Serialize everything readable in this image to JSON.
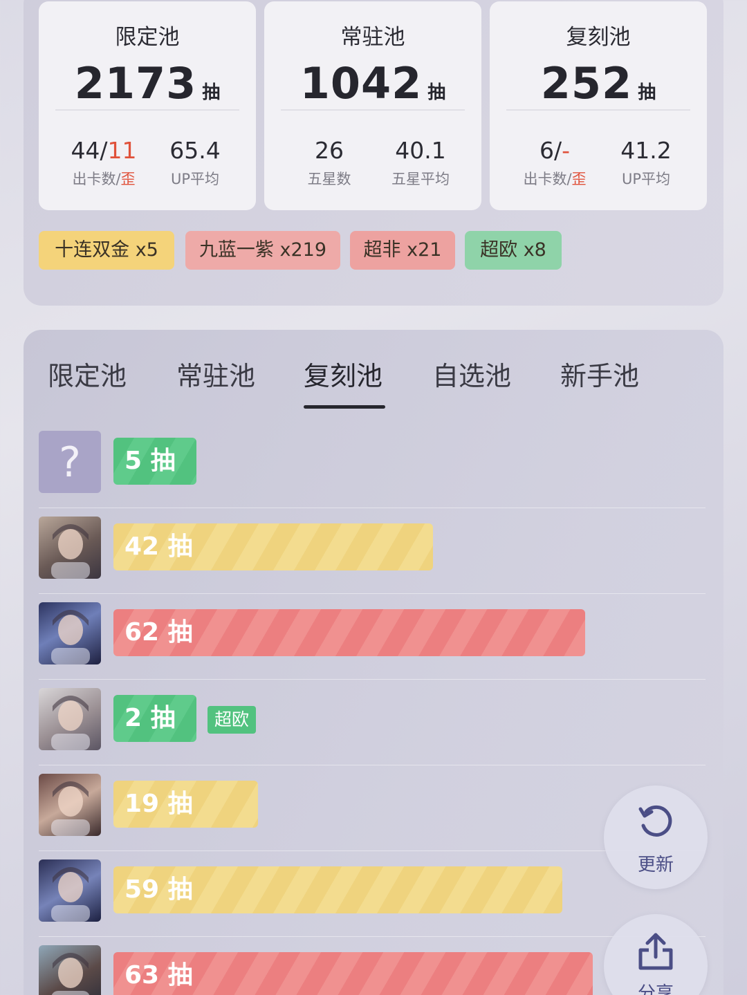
{
  "summary": {
    "cards": [
      {
        "title": "限定池",
        "count": "2173",
        "unit": "抽",
        "left_val_a": "44/",
        "left_val_b": "11",
        "left_lbl_a": "出卡数/",
        "left_lbl_b": "歪",
        "right_val": "65.4",
        "right_lbl": "UP平均"
      },
      {
        "title": "常驻池",
        "count": "1042",
        "unit": "抽",
        "left_val_a": "26",
        "left_val_b": "",
        "left_lbl_a": "五星数",
        "left_lbl_b": "",
        "right_val": "40.1",
        "right_lbl": "五星平均"
      },
      {
        "title": "复刻池",
        "count": "252",
        "unit": "抽",
        "left_val_a": "6/",
        "left_val_b": "-",
        "left_lbl_a": "出卡数/",
        "left_lbl_b": "歪",
        "right_val": "41.2",
        "right_lbl": "UP平均"
      }
    ],
    "tags": [
      {
        "label": "十连双金 x5",
        "color": "#f4d37a"
      },
      {
        "label": "九蓝一紫 x219",
        "color": "#eeaaa8"
      },
      {
        "label": "超非 x21",
        "color": "#eda2a0"
      },
      {
        "label": "超欧 x8",
        "color": "#8fd3a9"
      }
    ]
  },
  "tabs": [
    "限定池",
    "常驻池",
    "复刻池",
    "自选池",
    "新手池"
  ],
  "active_tab": "复刻池",
  "records": [
    {
      "avatar": "unknown-question-mark",
      "pulls": "5 抽",
      "value": 5,
      "color": "green",
      "badge": ""
    },
    {
      "avatar": "character-portrait",
      "pulls": "42 抽",
      "value": 42,
      "color": "yellow",
      "badge": ""
    },
    {
      "avatar": "character-portrait",
      "pulls": "62 抽",
      "value": 62,
      "color": "red",
      "badge": ""
    },
    {
      "avatar": "character-portrait",
      "pulls": "2 抽",
      "value": 2,
      "color": "green",
      "badge": "超欧"
    },
    {
      "avatar": "character-portrait",
      "pulls": "19 抽",
      "value": 19,
      "color": "yellow",
      "badge": ""
    },
    {
      "avatar": "character-portrait",
      "pulls": "59 抽",
      "value": 59,
      "color": "yellow",
      "badge": ""
    },
    {
      "avatar": "character-portrait",
      "pulls": "63 抽",
      "value": 63,
      "color": "red",
      "badge": ""
    }
  ],
  "actions": {
    "refresh": "更新",
    "share": "分享"
  }
}
